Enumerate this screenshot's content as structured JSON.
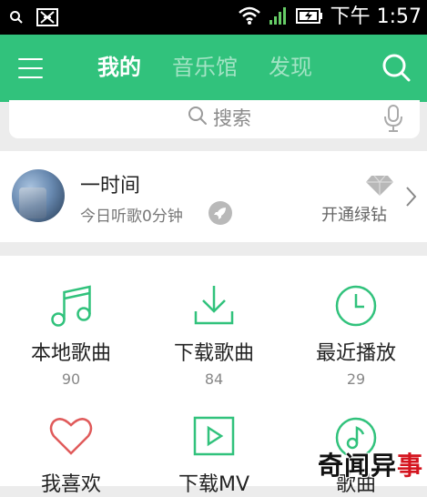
{
  "status_bar": {
    "time": "下午 1:57",
    "icons": [
      "search-icon",
      "app-notification-icon",
      "wifi-icon",
      "signal-icon",
      "battery-charging-icon"
    ]
  },
  "header": {
    "tabs": [
      {
        "label": "我的",
        "active": true
      },
      {
        "label": "音乐馆",
        "active": false
      },
      {
        "label": "发现",
        "active": false
      }
    ],
    "colors": {
      "brand": "#31c27c"
    }
  },
  "search": {
    "placeholder": "搜索"
  },
  "profile": {
    "username": "一时间",
    "listen_time": "今日听歌0分钟",
    "vip_label": "开通绿钻"
  },
  "grid": {
    "items": [
      {
        "label": "本地歌曲",
        "count": "90",
        "icon": "music-note-icon"
      },
      {
        "label": "下载歌曲",
        "count": "84",
        "icon": "download-icon"
      },
      {
        "label": "最近播放",
        "count": "29",
        "icon": "clock-icon"
      },
      {
        "label": "我喜欢",
        "icon": "heart-icon"
      },
      {
        "label": "下载MV",
        "icon": "play-box-icon"
      },
      {
        "label": "歌曲",
        "icon": "disc-music-icon"
      }
    ],
    "colors": {
      "accent": "#31c27c",
      "heart": "#e05a5a"
    }
  },
  "watermark": {
    "part1": "奇闻异",
    "part2": "事"
  }
}
